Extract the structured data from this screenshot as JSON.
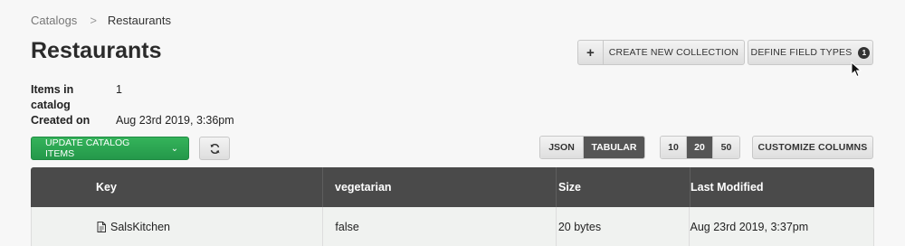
{
  "breadcrumb": {
    "parent": "Catalogs",
    "separator": ">",
    "current": "Restaurants"
  },
  "page_title": "Restaurants",
  "meta": [
    {
      "label": "Items in catalog",
      "value": "1"
    },
    {
      "label": "Created on",
      "value": "Aug 23rd 2019, 3:36pm"
    }
  ],
  "header_actions": {
    "create_plus": "+",
    "create_label": "CREATE NEW COLLECTION",
    "define_label": "DEFINE FIELD TYPES",
    "define_badge": "1"
  },
  "toolbar": {
    "update_label": "UPDATE CATALOG ITEMS",
    "update_chevron": "⌄",
    "refresh_icon": "refresh-icon",
    "format_options": [
      "JSON",
      "TABULAR"
    ],
    "format_selected": "TABULAR",
    "page_sizes": [
      "10",
      "20",
      "50"
    ],
    "page_size_selected": "20",
    "customize_label": "CUSTOMIZE COLUMNS"
  },
  "table": {
    "columns": [
      "Key",
      "vegetarian",
      "Size",
      "Last Modified"
    ],
    "rows": [
      {
        "key": "SalsKitchen",
        "vegetarian": "false",
        "size": "20 bytes",
        "last_modified": "Aug 23rd 2019, 3:37pm"
      }
    ]
  },
  "colors": {
    "primary_green": "#28a04d",
    "header_dark": "#4a4a4a",
    "active_segment": "#555555"
  }
}
